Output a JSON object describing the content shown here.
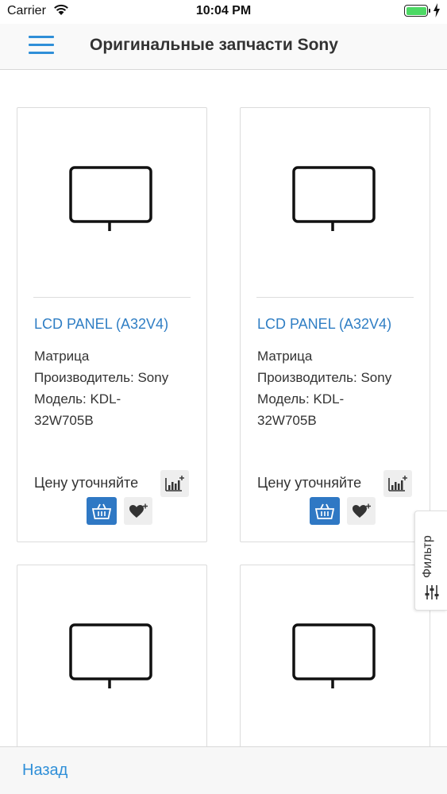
{
  "status_bar": {
    "carrier": "Carrier",
    "time": "10:04 PM",
    "battery_level": 1.0
  },
  "nav": {
    "title": "Оригинальные запчасти Sony",
    "menu_icon": "hamburger-menu-icon"
  },
  "products": [
    {
      "name": "LCD PANEL (A32V4)",
      "description_lines": [
        "Матрица",
        "Производитель: Sony",
        "Модель: KDL-",
        "32W705B"
      ],
      "price_label": "Цену уточняйте",
      "image_icon": "monitor-icon"
    },
    {
      "name": "LCD PANEL (A32V4)",
      "description_lines": [
        "Матрица",
        "Производитель: Sony",
        "Модель: KDL-",
        "32W705B"
      ],
      "price_label": "Цену уточняйте",
      "image_icon": "monitor-icon"
    }
  ],
  "filter": {
    "label": "Фильтр",
    "icon": "sliders-icon"
  },
  "bottom_bar": {
    "back_label": "Назад"
  },
  "colors": {
    "accent": "#2f8fd8",
    "link": "#2f7ec4",
    "cart_button": "#2f78c4",
    "battery": "#4cd964"
  }
}
